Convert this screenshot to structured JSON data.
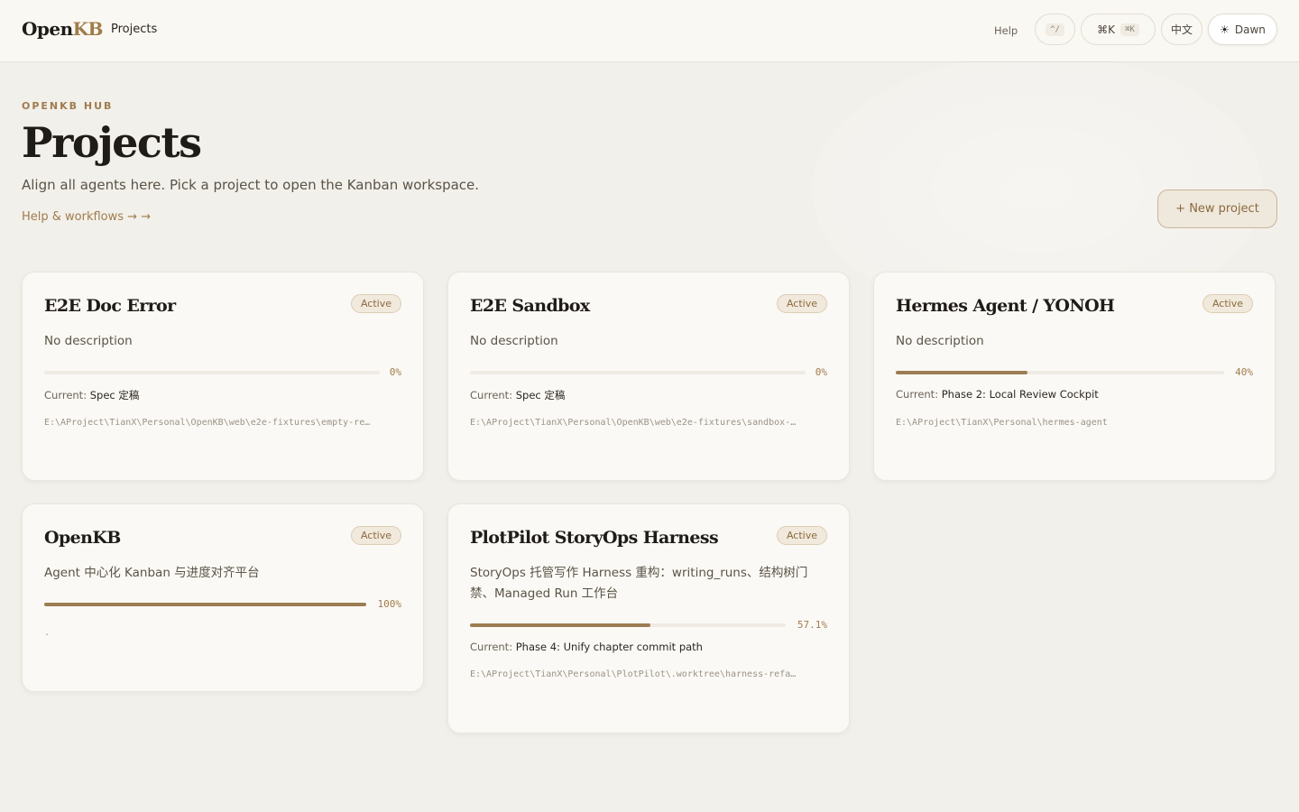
{
  "header": {
    "logo_main": "Open",
    "logo_accent": "KB",
    "nav_projects": "Projects",
    "help": "Help",
    "nav_shortcut": "^/",
    "search_symbol": "⌘K",
    "search_shortcut": "⌘K",
    "language": "中文",
    "theme_label": "Dawn"
  },
  "hero": {
    "eyebrow": "OPENKB HUB",
    "title": "Projects",
    "subtitle": "Align all agents here. Pick a project to open the Kanban workspace.",
    "help_link": "Help & workflows → →",
    "new_project": "+ New project"
  },
  "projects": [
    {
      "name": "E2E Doc Error",
      "status": "Active",
      "description": "No description",
      "progress": 0,
      "progress_label": "0%",
      "current_label": "Current:",
      "current_value": "Spec 定稿",
      "path": "E:\\AProject\\TianX\\Personal\\OpenKB\\web\\e2e-fixtures\\empty-re…"
    },
    {
      "name": "E2E Sandbox",
      "status": "Active",
      "description": "No description",
      "progress": 0,
      "progress_label": "0%",
      "current_label": "Current:",
      "current_value": "Spec 定稿",
      "path": "E:\\AProject\\TianX\\Personal\\OpenKB\\web\\e2e-fixtures\\sandbox-…"
    },
    {
      "name": "Hermes Agent / YONOH",
      "status": "Active",
      "description": "No description",
      "progress": 40,
      "progress_label": "40%",
      "current_label": "Current:",
      "current_value": "Phase 2: Local Review Cockpit",
      "path": "E:\\AProject\\TianX\\Personal\\hermes-agent"
    },
    {
      "name": "OpenKB",
      "status": "Active",
      "description": "Agent 中心化 Kanban 与进度对齐平台",
      "progress": 100,
      "progress_label": "100%",
      "path": "."
    },
    {
      "name": "PlotPilot StoryOps Harness",
      "status": "Active",
      "description": "StoryOps 托管写作 Harness 重构：writing_runs、结构树门禁、Managed Run 工作台",
      "progress": 57.1,
      "progress_label": "57.1%",
      "current_label": "Current:",
      "current_value": "Phase 4: Unify chapter commit path",
      "path": "E:\\AProject\\TianX\\Personal\\PlotPilot\\.worktree\\harness-refa…"
    }
  ]
}
